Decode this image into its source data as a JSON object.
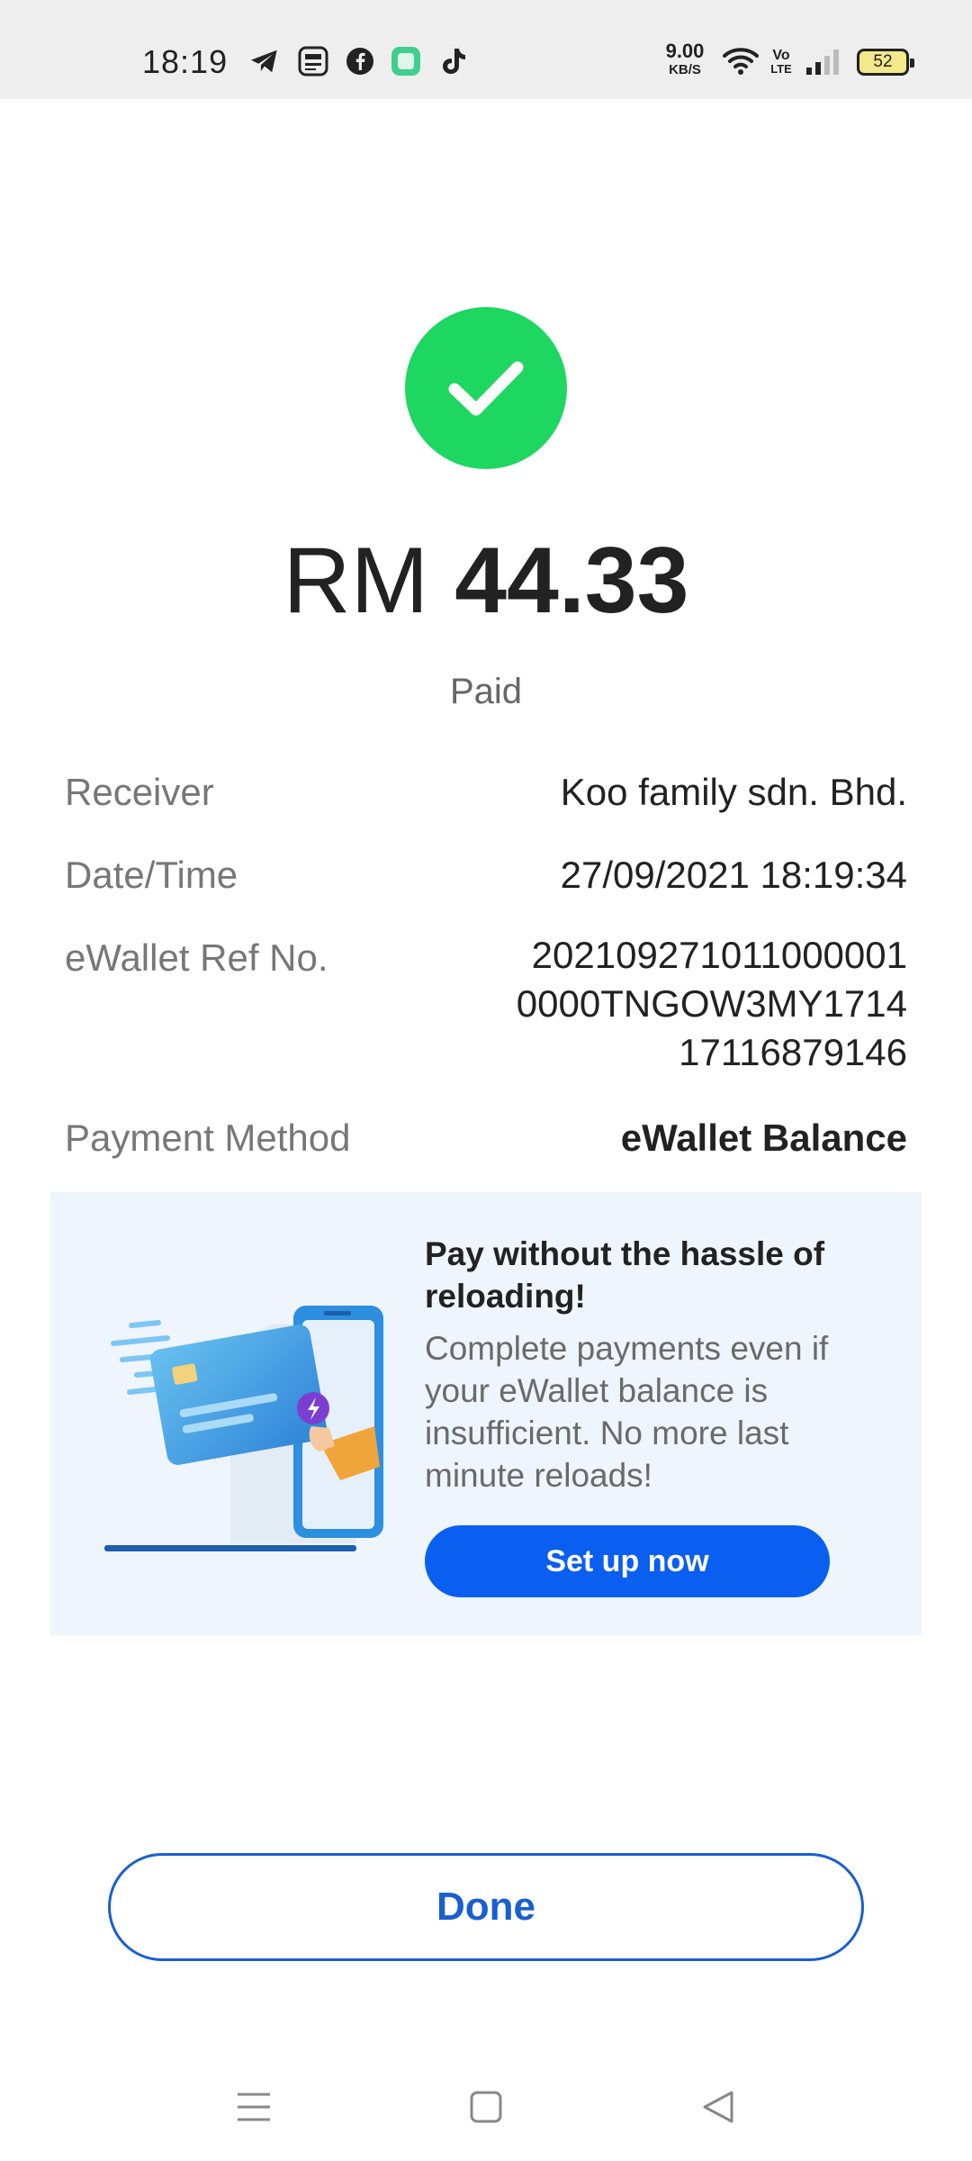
{
  "status_bar": {
    "time": "18:19",
    "network_speed_value": "9.00",
    "network_speed_unit": "KB/S",
    "volte_top": "Vo",
    "volte_bottom": "LTE",
    "battery_level": "52",
    "notification_icons": [
      "telegram-icon",
      "touch-n-go-icon",
      "facebook-icon",
      "green-app-icon",
      "tiktok-icon"
    ]
  },
  "payment": {
    "status_icon": "check-icon",
    "currency": "RM",
    "amount": "44.33",
    "status": "Paid"
  },
  "details": {
    "receiver": {
      "label": "Receiver",
      "value": "Koo family sdn. Bhd."
    },
    "datetime": {
      "label": "Date/Time",
      "value": "27/09/2021 18:19:34"
    },
    "ref": {
      "label": "eWallet Ref No.",
      "lines": [
        "202109271011000001",
        "0000TNGOW3MY1714",
        "17116879146"
      ]
    },
    "method": {
      "label": "Payment Method",
      "value": "eWallet Balance"
    }
  },
  "promo": {
    "title": "Pay without the hassle of reloading!",
    "body": "Complete payments even if your eWallet balance is insufficient. No more last minute reloads!",
    "button_label": "Set up now"
  },
  "done_label": "Done",
  "colors": {
    "success_green": "#1ed760",
    "primary_blue": "#0a5ef0",
    "done_outline": "#1a5fd0",
    "promo_bg": "#eef5fc"
  }
}
